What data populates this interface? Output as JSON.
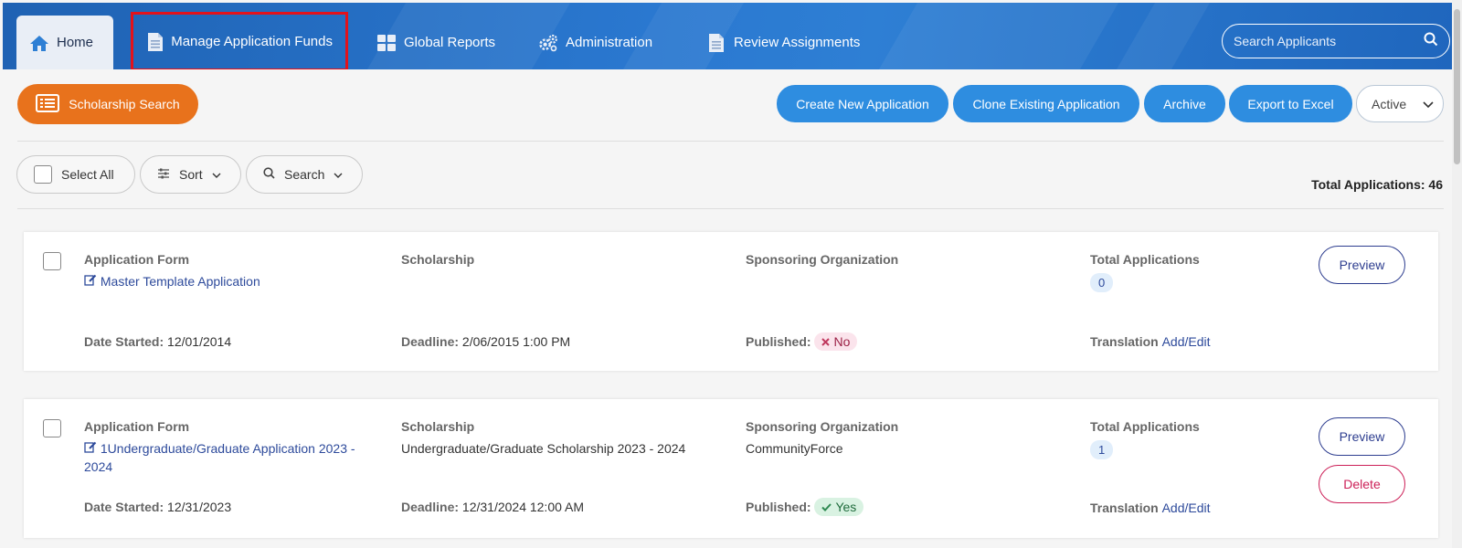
{
  "nav": {
    "items": [
      {
        "label": "Home",
        "icon": "home-icon"
      },
      {
        "label": "Manage Application Funds",
        "icon": "document-icon"
      },
      {
        "label": "Global Reports",
        "icon": "grid-icon"
      },
      {
        "label": "Administration",
        "icon": "gears-icon"
      },
      {
        "label": "Review Assignments",
        "icon": "document-icon"
      }
    ],
    "search_placeholder": "Search Applicants"
  },
  "toolbar": {
    "scholarship_search": "Scholarship Search",
    "create_new": "Create New Application",
    "clone_existing": "Clone Existing Application",
    "archive": "Archive",
    "export": "Export to Excel",
    "status_selected": "Active"
  },
  "filters": {
    "select_all": "Select All",
    "sort": "Sort",
    "search": "Search",
    "total_label": "Total Applications: 46"
  },
  "labels": {
    "application_form": "Application Form",
    "scholarship": "Scholarship",
    "sponsoring_org": "Sponsoring Organization",
    "total_applications": "Total Applications",
    "date_started": "Date Started:",
    "deadline": "Deadline:",
    "published": "Published:",
    "translation": "Translation",
    "add_edit": "Add/Edit",
    "preview": "Preview",
    "delete": "Delete"
  },
  "applications": [
    {
      "form_name": "Master Template Application",
      "scholarship": "",
      "organization": "",
      "total": "0",
      "date_started": "12/01/2014",
      "deadline": "2/06/2015 1:00 PM",
      "published": "No"
    },
    {
      "form_name_line1": "1Undergraduate/Graduate Application 2023 -",
      "form_name_line2": "2024",
      "scholarship": "Undergraduate/Graduate Scholarship 2023 - 2024",
      "organization": "CommunityForce",
      "total": "1",
      "date_started": "12/31/2023",
      "deadline": "12/31/2024 12:00 AM",
      "published": "Yes"
    }
  ],
  "colors": {
    "nav_blue": "#2a78d0",
    "orange": "#e8721c",
    "button_blue": "#2e8de0",
    "link": "#2d4a9b",
    "highlight_red": "#e3121b"
  }
}
